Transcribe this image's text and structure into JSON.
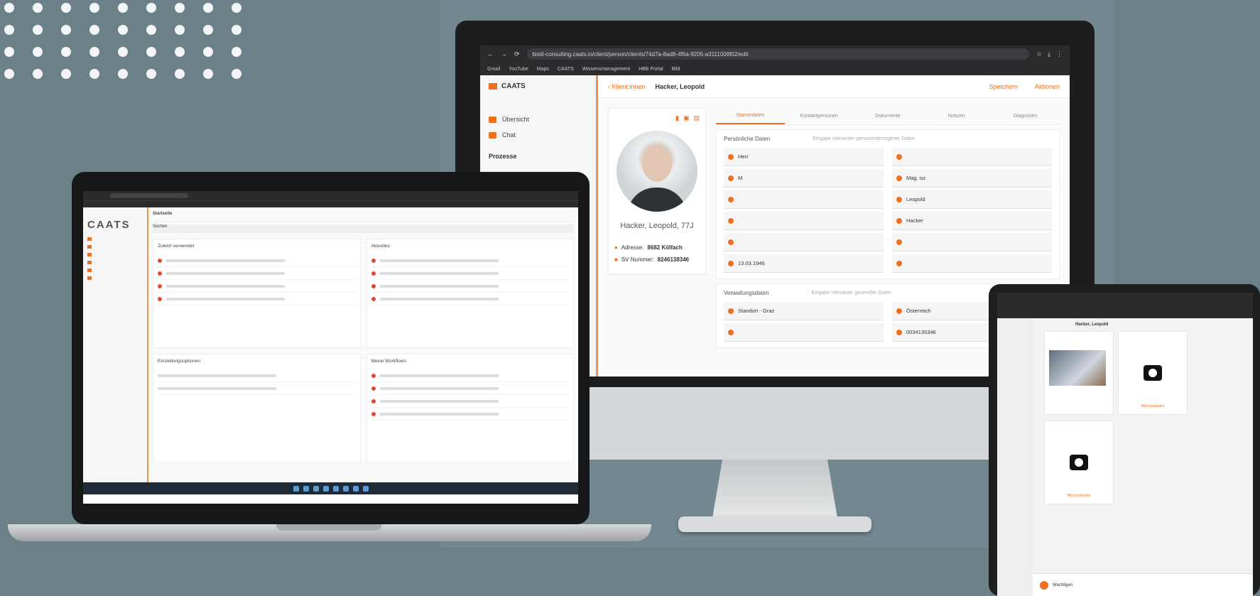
{
  "monitor": {
    "url": "bistil-consulting.caats.io/client/person/clients/74d7a-8ad8-4f6a-9205-a3111008f02/edit",
    "bookmarks": [
      "Gmail",
      "YouTube",
      "Maps",
      "CAATS",
      "Wissensmanagement",
      "HBB Portal",
      "Bild"
    ],
    "logo": "CAATS",
    "nav": [
      "Übersicht",
      "Chat"
    ],
    "nav_section": "Prozesse",
    "header": {
      "back": "Klient:innen",
      "client": "Hacker, Leopold",
      "save": "Speichern",
      "action": "Aktionen"
    },
    "profile": {
      "name": "Hacker, Leopold, 77J",
      "address_label": "Adresse:",
      "address": "8682 Kölfach",
      "sv_label": "SV Nummer:",
      "sv": "8246138346"
    },
    "tabs": [
      "Stammdaten",
      "Kontaktpersonen",
      "Dokumente",
      "Notizen",
      "Diagnosen"
    ],
    "personal": {
      "title": "Persönliche Daten",
      "subtitle": "Eingabe relevanter personenbezogener Daten",
      "fields": [
        "Herr",
        "",
        "M",
        "Mag. iur.",
        "",
        "Leopold",
        "",
        "Hacker",
        "",
        "",
        "13.03.1946",
        ""
      ]
    },
    "admin": {
      "title": "Verwaltungsdaten",
      "subtitle": "Eingabe relevanter genereller Daten",
      "fields": [
        "Standort - Graz",
        "Österreich",
        "",
        "0034135346"
      ]
    }
  },
  "laptop": {
    "logo": "CAATS",
    "page_title": "Startseite",
    "search": "Suchen",
    "cards": [
      "Zuletzt verwendet",
      "Aktuelles",
      "Einstellungsoptionen",
      "Meine Workflows"
    ]
  },
  "tablet": {
    "client": "Hacker, Leopold",
    "upload": "Bild hochladen",
    "footer": "Wachtlgen"
  },
  "colors": {
    "accent": "#ee6f1f",
    "background": "#6c8087"
  }
}
